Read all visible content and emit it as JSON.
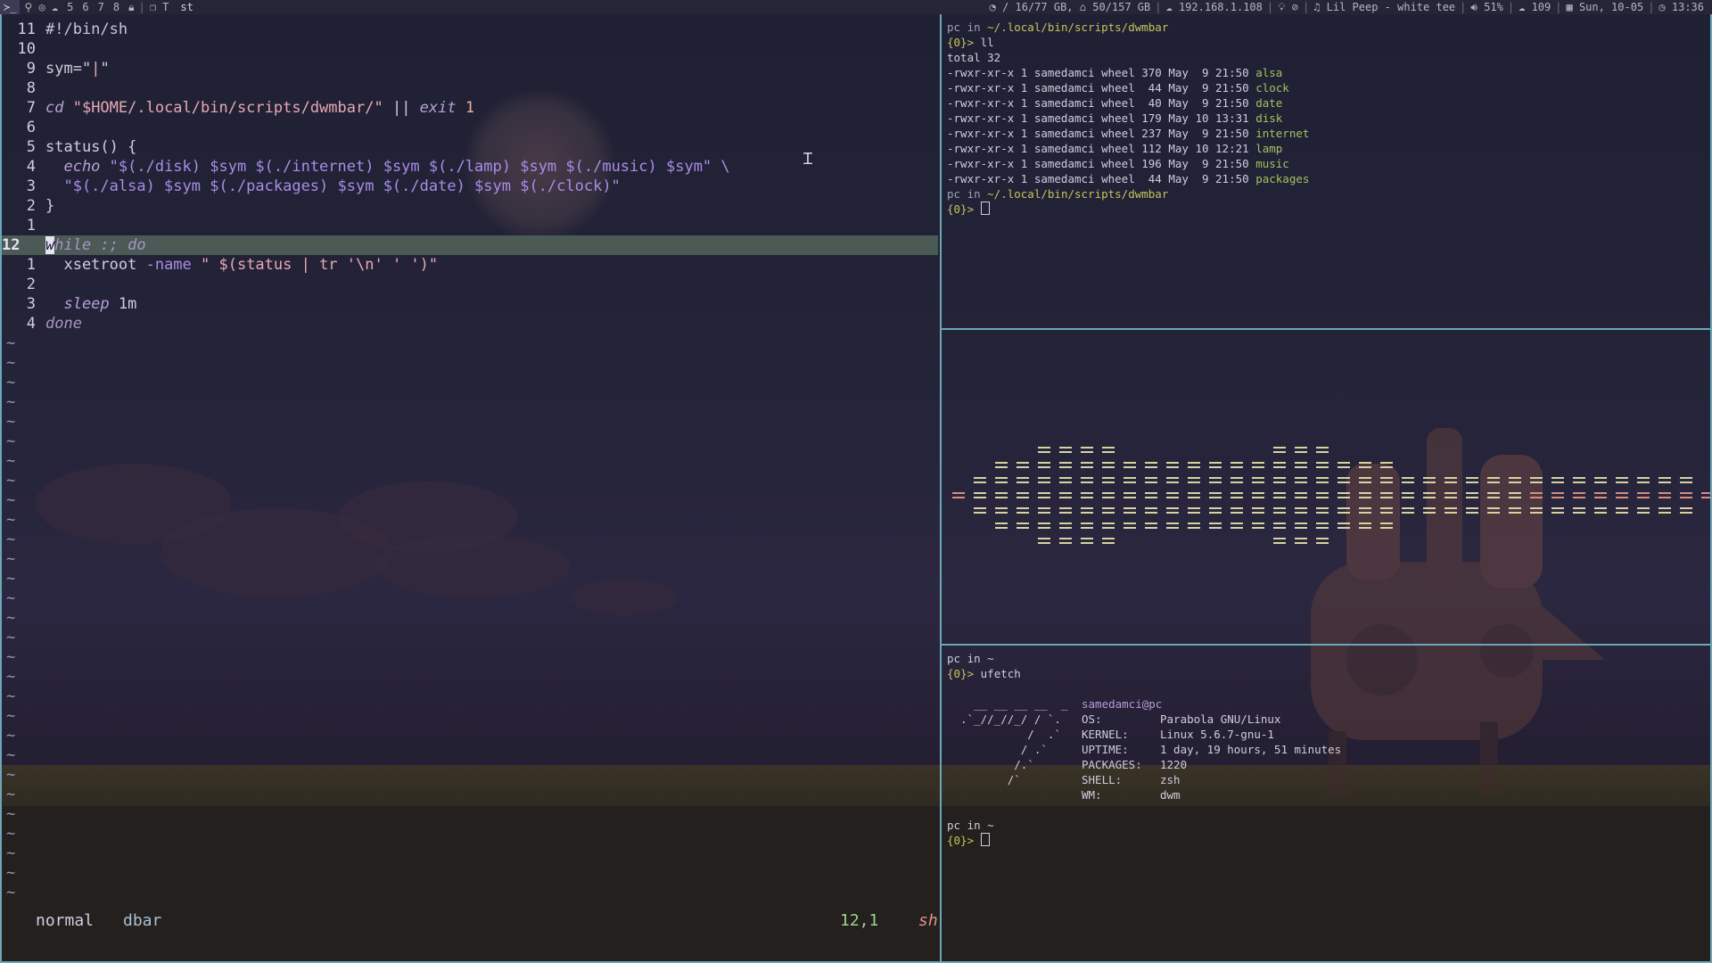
{
  "topbar": {
    "launcher": "≻_",
    "tags": [
      "5",
      "6",
      "7",
      "8"
    ],
    "layout": "T",
    "window_title": "st",
    "root_usage": "/ 16/77 GB,",
    "home_usage": "50/157 GB",
    "ip": "192.168.1.108",
    "now_playing": "Lil Peep - white tee",
    "volume": "51%",
    "packages": "109",
    "date": "Sun, 10-05",
    "time": "13:36"
  },
  "vim": {
    "lines": [
      {
        "num": "11",
        "cur": false
      },
      {
        "num": "10",
        "cur": false
      },
      {
        "num": "9",
        "cur": false
      },
      {
        "num": "8",
        "cur": false
      },
      {
        "num": "7",
        "cur": false
      },
      {
        "num": "6",
        "cur": false
      },
      {
        "num": "5",
        "cur": false
      },
      {
        "num": "4",
        "cur": false
      },
      {
        "num": "3",
        "cur": false
      },
      {
        "num": "2",
        "cur": false
      },
      {
        "num": "1",
        "cur": false
      },
      {
        "num": "12",
        "cur": true
      },
      {
        "num": "1",
        "cur": false
      },
      {
        "num": "2",
        "cur": false
      },
      {
        "num": "3",
        "cur": false
      },
      {
        "num": "4",
        "cur": false
      }
    ],
    "code": {
      "l0": "#!/bin/sh",
      "l2_a": "sym=\"",
      "l2_b": "|",
      "l2_c": "\"",
      "l4_a": "cd",
      "l4_b": " \"$HOME/.local/bin/scripts/dwmbar/\"",
      "l4_c": " || ",
      "l4_d": "exit",
      "l4_e": " 1",
      "l6": "status() {",
      "l7_a": "  echo",
      "l7_b": " \"$(./disk) $sym $(./internet) $sym $(./lamp) $sym $(./music) $sym\" \\",
      "l8": "  \"$(./alsa) $sym $(./packages) $sym $(./date) $sym $(./clock)\"",
      "l9": "}",
      "l11_cursor": "w",
      "l11_rest": "hile :; do",
      "l12_a": "  xsetroot",
      "l12_b": " -name",
      "l12_c": " \" $(status | tr '\\n' ' ')\"",
      "l14_a": "  sleep",
      "l14_b": " 1m",
      "l15": "done"
    },
    "tilde": "~",
    "status": {
      "mode": "normal",
      "file": "dbar",
      "position": "12,1",
      "filetype": "sh"
    }
  },
  "term1": {
    "prompt1_user": "pc in ",
    "prompt1_path": "~/.local/bin/scripts/dwmbar",
    "prompt1_cmd_prefix": "{0}> ",
    "prompt1_cmd": "ll",
    "total": "total 32",
    "files": [
      {
        "meta": "-rwxr-xr-x 1 samedamci wheel 370 May  9 21:50 ",
        "name": "alsa"
      },
      {
        "meta": "-rwxr-xr-x 1 samedamci wheel  44 May  9 21:50 ",
        "name": "clock"
      },
      {
        "meta": "-rwxr-xr-x 1 samedamci wheel  40 May  9 21:50 ",
        "name": "date"
      },
      {
        "meta": "-rwxr-xr-x 1 samedamci wheel 179 May 10 13:31 ",
        "name": "disk"
      },
      {
        "meta": "-rwxr-xr-x 1 samedamci wheel 237 May  9 21:50 ",
        "name": "internet"
      },
      {
        "meta": "-rwxr-xr-x 1 samedamci wheel 112 May 10 12:21 ",
        "name": "lamp"
      },
      {
        "meta": "-rwxr-xr-x 1 samedamci wheel 196 May  9 21:50 ",
        "name": "music"
      },
      {
        "meta": "-rwxr-xr-x 1 samedamci wheel  44 May  9 21:50 ",
        "name": "packages"
      }
    ],
    "prompt2_user": "pc in ",
    "prompt2_path": "~/.local/bin/scripts/dwmbar",
    "prompt2_cmd_prefix": "{0}> "
  },
  "term3": {
    "prompt1_user": "pc in ~",
    "prompt1_cmd_prefix": "{0}> ",
    "prompt1_cmd": "ufetch",
    "logo": [
      "    __ __ __ __  _",
      "  .`_//_//_/ / `.",
      "            /  .`",
      "           / .`",
      "          /.`",
      "         /`"
    ],
    "user_host": "samedamci@pc",
    "info": [
      {
        "key": "OS:",
        "val": "Parabola GNU/Linux"
      },
      {
        "key": "KERNEL:",
        "val": "Linux 5.6.7-gnu-1"
      },
      {
        "key": "UPTIME:",
        "val": "1 day, 19 hours, 51 minutes"
      },
      {
        "key": "PACKAGES:",
        "val": "1220"
      },
      {
        "key": "SHELL:",
        "val": "zsh"
      },
      {
        "key": "WM:",
        "val": "dwm"
      }
    ],
    "prompt2_user": "pc in ~",
    "prompt2_cmd_prefix": "{0}> "
  },
  "visualizer": {
    "columns": [
      1,
      3,
      5,
      5,
      7,
      7,
      7,
      7,
      5,
      5,
      5,
      4,
      4,
      4,
      4,
      6,
      6,
      6,
      4,
      4,
      4,
      2,
      2,
      2,
      2,
      2,
      2,
      2,
      2,
      2,
      2,
      2,
      2,
      2,
      2,
      1,
      1
    ],
    "pale_color": "#d8d2a3",
    "red_color": "#d98b86"
  },
  "colors": {
    "border": "#6aa8b8",
    "path": "#c7c35b",
    "filename": "#a3c25e"
  }
}
